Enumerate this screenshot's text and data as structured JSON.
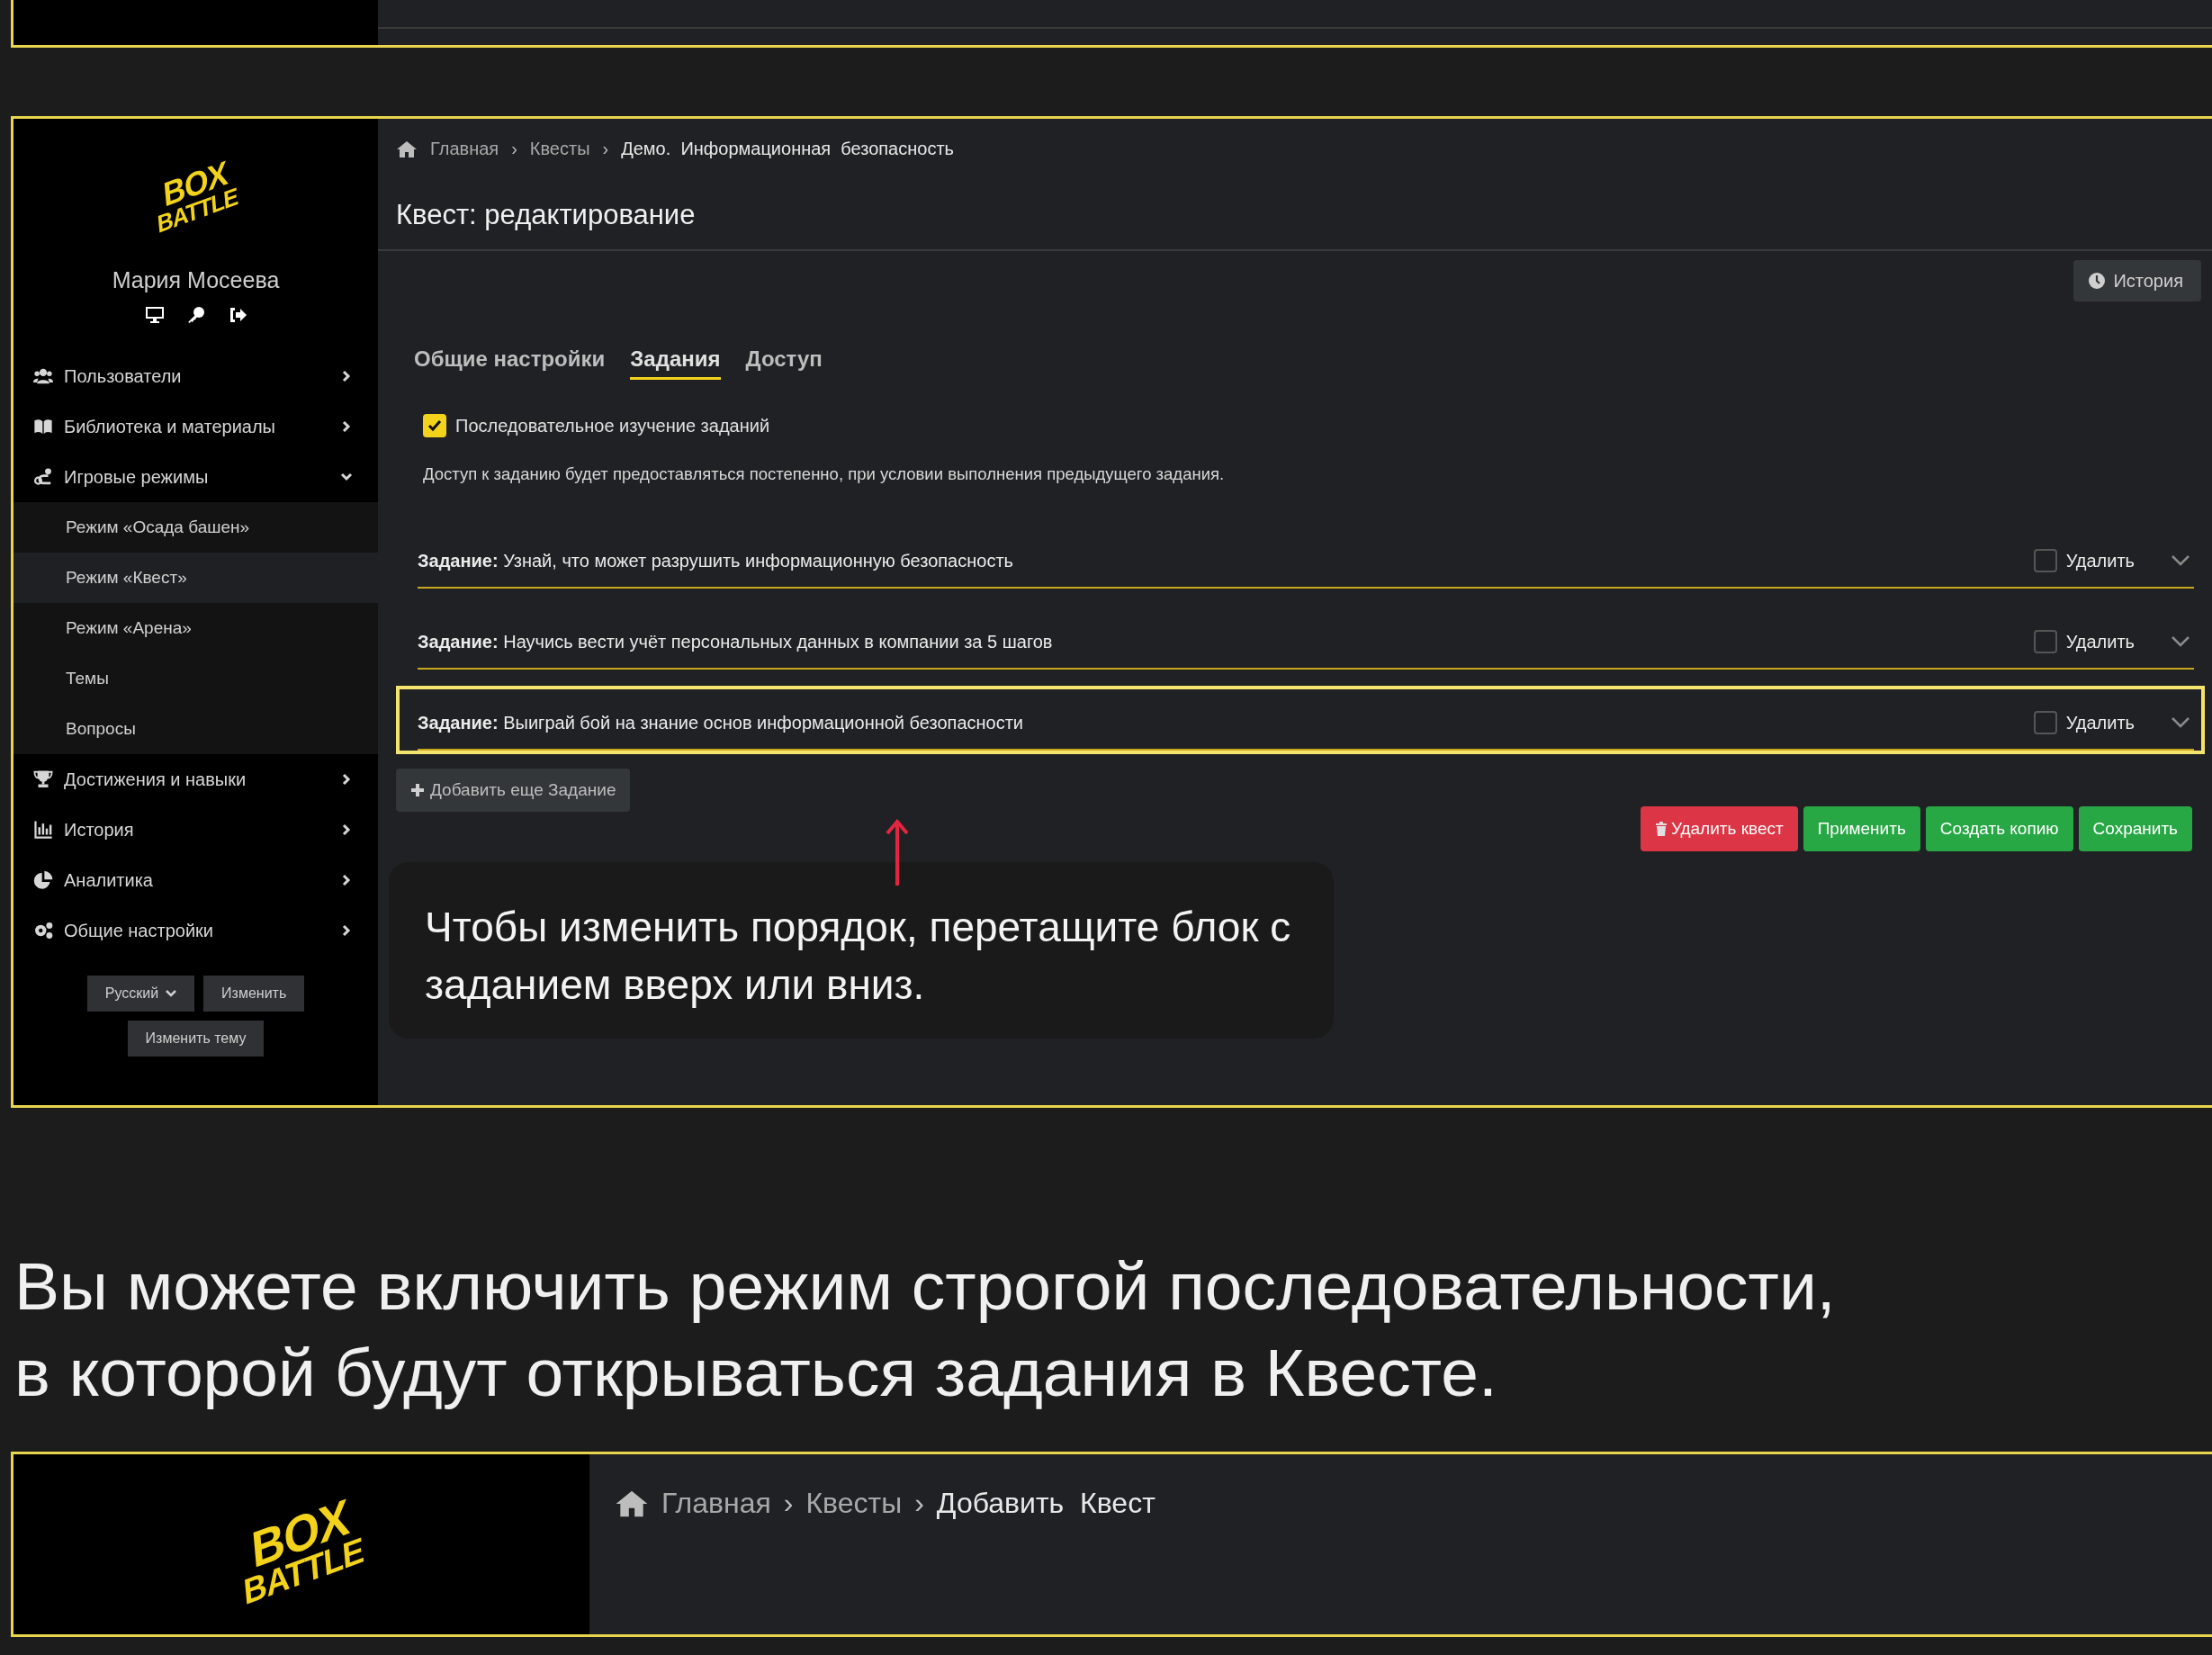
{
  "logo": {
    "line_1": "BOX",
    "line_2": "BATTLE"
  },
  "sidebar": {
    "user_name": "Мария Мосеева",
    "nav": [
      {
        "label": "Пользователи",
        "expanded": false
      },
      {
        "label": "Библиотека и материалы",
        "expanded": false
      },
      {
        "label": "Игровые режимы",
        "expanded": true,
        "children": [
          {
            "label": "Режим «Осада башен»",
            "selected": false
          },
          {
            "label": "Режим «Квест»",
            "selected": true
          },
          {
            "label": "Режим «Арена»",
            "selected": false
          },
          {
            "label": "Темы",
            "selected": false
          },
          {
            "label": "Вопросы",
            "selected": false
          }
        ]
      },
      {
        "label": "Достижения и навыки",
        "expanded": false
      },
      {
        "label": "История",
        "expanded": false
      },
      {
        "label": "Аналитика",
        "expanded": false
      },
      {
        "label": "Общие настройки",
        "expanded": false
      }
    ],
    "language": "Русский",
    "change_button": "Изменить",
    "theme_button": "Изменить тему"
  },
  "main": {
    "breadcrumb": [
      {
        "label": "Главная",
        "current": false
      },
      {
        "separator": "›",
        "label": "Квесты",
        "current": false
      },
      {
        "separator": "›",
        "label": "Демо.  Информационная  безопасность",
        "current": true
      }
    ],
    "title": "Квест: редактирование",
    "history_button": "История",
    "tabs": [
      {
        "label": "Общие настройки",
        "selected": false
      },
      {
        "label": "Задания",
        "selected": true
      },
      {
        "label": "Доступ",
        "selected": false
      }
    ],
    "sequential": {
      "label": "Последовательное изучение заданий",
      "checked": true
    },
    "description": "Доступ к заданию будет предоставляться постепенно, при условии выполнения предыдущего задания.",
    "tasks": [
      {
        "text": "**Задание:** Узнай, что может разрушить информационную безопасность",
        "delete_label": "Удалить",
        "delete_checked": false,
        "highlighted": false
      },
      {
        "text": "**Задание:** Научись вести учёт персональных данных в компании за 5 шагов",
        "delete_label": "Удалить",
        "delete_checked": false,
        "highlighted": false
      },
      {
        "text": "**Задание:** Выиграй бой на знание основ информационной безопасности",
        "delete_label": "Удалить",
        "delete_checked": false,
        "highlighted": true
      }
    ],
    "add_button": "Добавить еще Задание",
    "actions": [
      {
        "label": "Удалить квест",
        "kind": "danger"
      },
      {
        "label": "Применить",
        "kind": "success"
      },
      {
        "label": "Создать копию",
        "kind": "success"
      },
      {
        "label": "Сохранить",
        "kind": "success"
      }
    ],
    "callout": "Чтобы изменить порядок, перетащите блок с заданием вверх или вниз."
  },
  "caption": [
    "Вы можете включить режим строгой последовательности,",
    "в которой будут открываться задания в Квесте."
  ],
  "next_screen": {
    "logo": {
      "line_1": "BOX",
      "line_2": "BATTLE"
    },
    "breadcrumb": [
      {
        "label": "Главная",
        "current": false
      },
      {
        "separator": "›",
        "label": "Квесты",
        "current": false
      },
      {
        "separator": "›",
        "label": "Добавить  Квест",
        "current": true
      }
    ]
  }
}
